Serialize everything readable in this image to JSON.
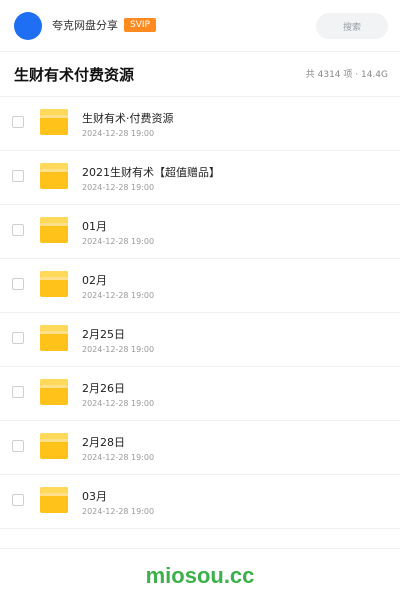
{
  "header": {
    "username": "夸克网盘分享",
    "badge": "SVIP",
    "search_placeholder": "搜索"
  },
  "title_bar": {
    "title": "生财有术付费资源",
    "stats": "共 4314 项 · 14.4G"
  },
  "files": [
    {
      "name": " 生财有术·付费资源",
      "date": "2024-12-28 19:00"
    },
    {
      "name": "2021生财有术【超值赠品】",
      "date": "2024-12-28 19:00"
    },
    {
      "name": "01月",
      "date": "2024-12-28 19:00"
    },
    {
      "name": "02月",
      "date": "2024-12-28 19:00"
    },
    {
      "name": "2月25日",
      "date": "2024-12-28 19:00"
    },
    {
      "name": "2月26日",
      "date": "2024-12-28 19:00"
    },
    {
      "name": "2月28日",
      "date": "2024-12-28 19:00"
    },
    {
      "name": "03月",
      "date": "2024-12-28 19:00"
    }
  ],
  "footer": {
    "watermark": "miosou.cc"
  },
  "colors": {
    "avatar": "#1f6ff5",
    "svip": "#ff8a1f",
    "folder": "#ffc21a",
    "watermark": "#3cb04a"
  },
  "icons": {
    "folder": "folder-icon"
  }
}
